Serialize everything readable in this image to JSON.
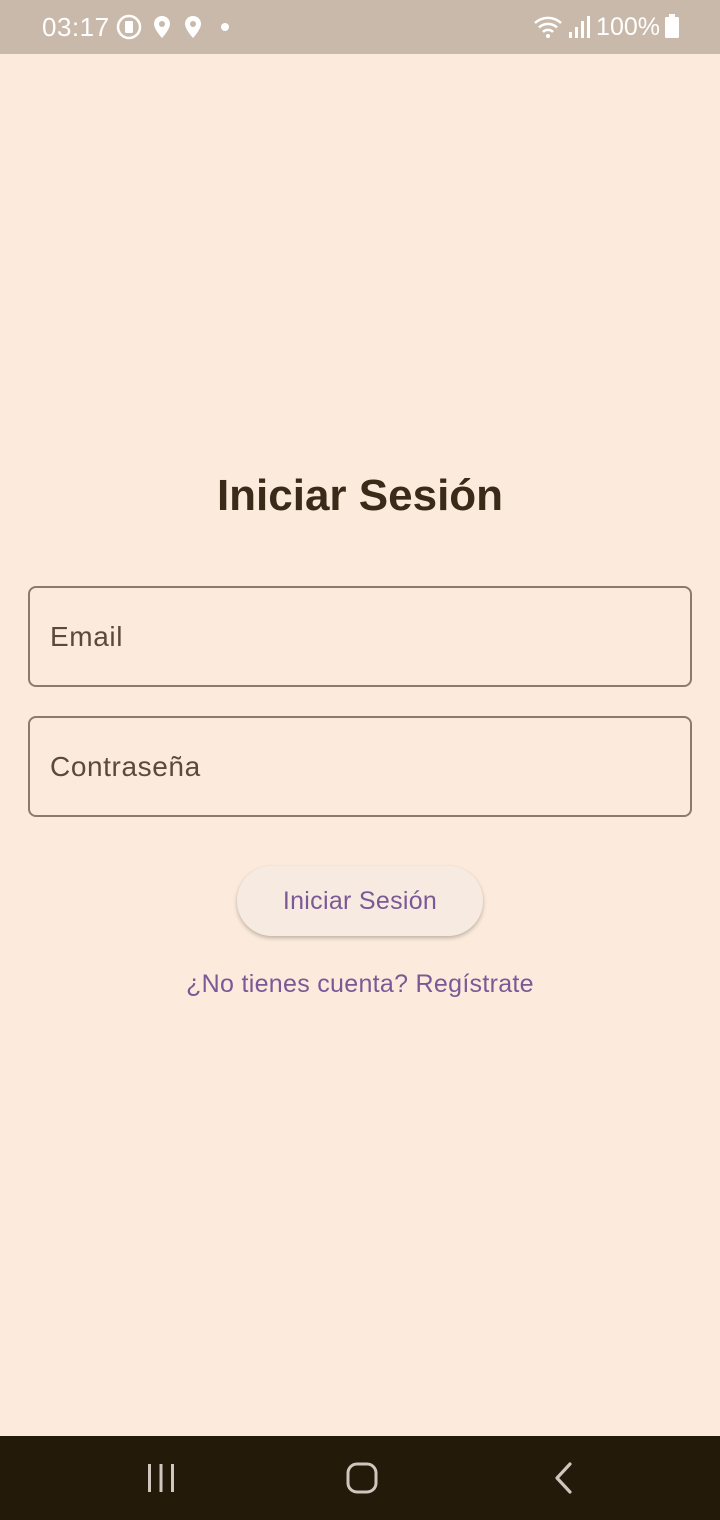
{
  "status_bar": {
    "time": "03:17",
    "battery": "100%",
    "icons": [
      "data-saver-icon",
      "location-icon",
      "location-icon",
      "dot-icon",
      "wifi-icon",
      "signal-icon",
      "battery-icon"
    ]
  },
  "login": {
    "title": "Iniciar Sesión",
    "email_label": "Email",
    "password_label": "Contraseña",
    "submit_label": "Iniciar Sesión",
    "register_link": "¿No tienes cuenta? Regístrate"
  },
  "colors": {
    "background": "#fcebdc",
    "accent": "#7b5896",
    "title": "#3a2a18",
    "status_bar": "#c9b9aa",
    "nav_bar": "#231a0a"
  },
  "nav_bar": {
    "buttons": [
      "recent-apps-icon",
      "home-icon",
      "back-icon"
    ]
  }
}
